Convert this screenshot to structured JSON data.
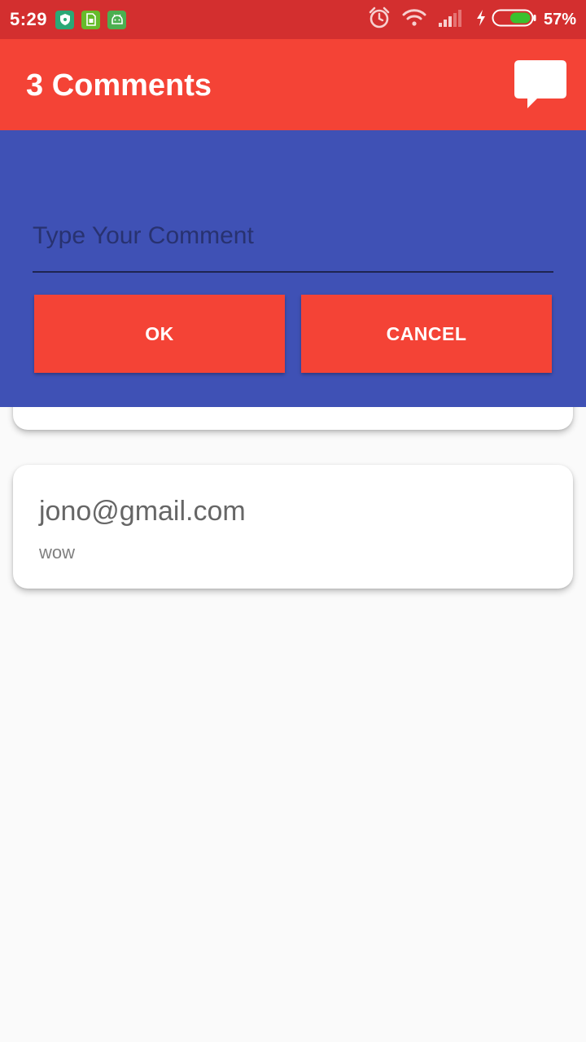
{
  "status_bar": {
    "time": "5:29",
    "battery_percent": "57%",
    "battery_level": 0.57,
    "notification_icons": [
      "shield-icon",
      "sim-card-icon",
      "android-icon"
    ],
    "system_icons": [
      "alarm-icon",
      "wifi-icon",
      "signal-icon",
      "charging-icon",
      "battery-icon"
    ]
  },
  "app_bar": {
    "title": "3 Comments",
    "action_icon": "chat-bubble-icon"
  },
  "comment_form": {
    "placeholder": "Type Your Comment",
    "value": "",
    "ok_label": "OK",
    "cancel_label": "CANCEL"
  },
  "comments": [
    {
      "email": "jono@gmail.com",
      "text": "wow"
    }
  ],
  "colors": {
    "status_bar": "#d32f2f",
    "primary": "#f44336",
    "panel": "#3f51b5",
    "background": "#fafafa"
  }
}
